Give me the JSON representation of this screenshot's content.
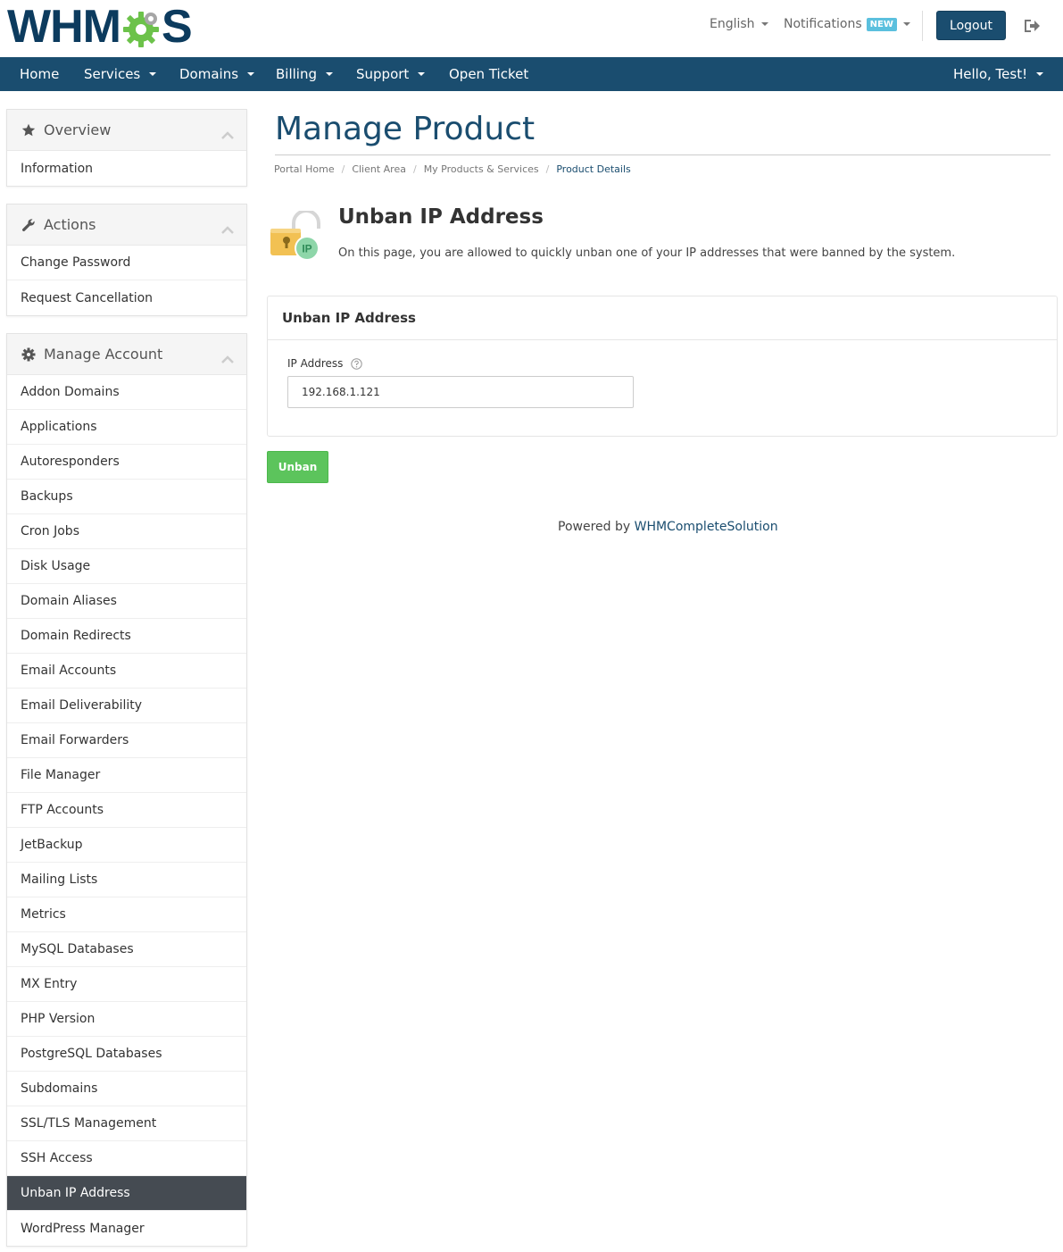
{
  "brand": {
    "logo_left": "WHM",
    "logo_right": "S"
  },
  "topbar": {
    "language": "English",
    "notifications": "Notifications",
    "notifications_badge": "NEW",
    "logout": "Logout"
  },
  "nav": {
    "items": [
      "Home",
      "Services",
      "Domains",
      "Billing",
      "Support",
      "Open Ticket"
    ],
    "user": "Hello, Test!"
  },
  "sidebar": {
    "overview": {
      "title": "Overview",
      "items": [
        "Information"
      ]
    },
    "actions": {
      "title": "Actions",
      "items": [
        "Change Password",
        "Request Cancellation"
      ]
    },
    "manage": {
      "title": "Manage Account",
      "items": [
        "Addon Domains",
        "Applications",
        "Autoresponders",
        "Backups",
        "Cron Jobs",
        "Disk Usage",
        "Domain Aliases",
        "Domain Redirects",
        "Email Accounts",
        "Email Deliverability",
        "Email Forwarders",
        "File Manager",
        "FTP Accounts",
        "JetBackup",
        "Mailing Lists",
        "Metrics",
        "MySQL Databases",
        "MX Entry",
        "PHP Version",
        "PostgreSQL Databases",
        "Subdomains",
        "SSL/TLS Management",
        "SSH Access",
        "Unban IP Address",
        "WordPress Manager"
      ],
      "active": "Unban IP Address"
    }
  },
  "main": {
    "page_title": "Manage Product",
    "breadcrumb": [
      "Portal Home",
      "Client Area",
      "My Products & Services",
      "Product Details"
    ],
    "section_title": "Unban IP Address",
    "section_desc": "On this page, you are allowed to quickly unban one of your IP addresses that were banned by the system.",
    "icon_label": "IP",
    "card_title": "Unban IP Address",
    "field_label": "IP Address",
    "field_value": "192.168.1.121",
    "unban_button": "Unban",
    "powered_prefix": "Powered by",
    "powered_link": "WHMCompleteSolution"
  },
  "colors": {
    "primary": "#1a4d6f",
    "success": "#5cc45c",
    "active_bg": "#454b52",
    "badge": "#5bc0de",
    "logo_green": "#6cc24a"
  },
  "icons": [
    "star-icon",
    "wrench-icon",
    "gear-icon",
    "chevron-up-icon",
    "exit-icon",
    "help-icon",
    "unlock-ip-icon"
  ]
}
